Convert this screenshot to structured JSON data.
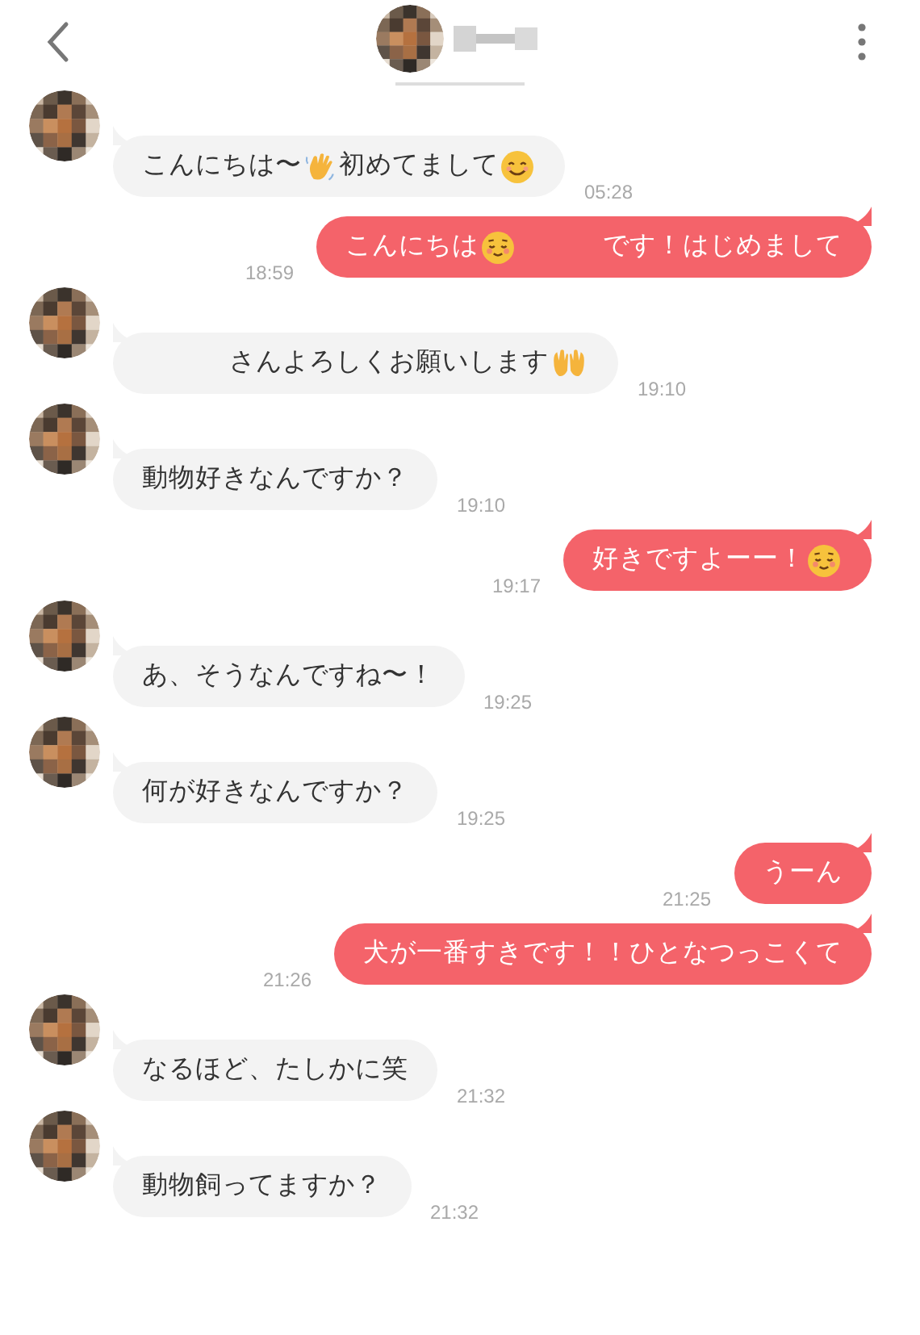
{
  "messages": [
    {
      "kind": "received",
      "time": "05:28",
      "parts": [
        {
          "kind": "text",
          "text": "こんにちは〜"
        },
        {
          "kind": "wave"
        },
        {
          "kind": "text",
          "text": "初めてまして"
        },
        {
          "kind": "smile"
        }
      ]
    },
    {
      "kind": "sent",
      "time": "18:59",
      "parts": [
        {
          "kind": "text",
          "text": "こんにちは"
        },
        {
          "kind": "relieved"
        },
        {
          "kind": "gap"
        },
        {
          "kind": "text",
          "text": "です！はじめまして"
        }
      ]
    },
    {
      "kind": "received",
      "time": "19:10",
      "parts": [
        {
          "kind": "gap"
        },
        {
          "kind": "text",
          "text": "さんよろしくお願いします"
        },
        {
          "kind": "hands"
        }
      ]
    },
    {
      "kind": "received",
      "time": "19:10",
      "parts": [
        {
          "kind": "text",
          "text": "動物好きなんですか？"
        }
      ]
    },
    {
      "kind": "sent",
      "time": "19:17",
      "parts": [
        {
          "kind": "text",
          "text": "好きですよーー！"
        },
        {
          "kind": "relieved"
        }
      ]
    },
    {
      "kind": "received",
      "time": "19:25",
      "parts": [
        {
          "kind": "text",
          "text": "あ、そうなんですね〜！"
        }
      ]
    },
    {
      "kind": "received",
      "time": "19:25",
      "parts": [
        {
          "kind": "text",
          "text": "何が好きなんですか？"
        }
      ]
    },
    {
      "kind": "sent",
      "time": "21:25",
      "parts": [
        {
          "kind": "text",
          "text": "うーん"
        }
      ]
    },
    {
      "kind": "sent",
      "time": "21:26",
      "parts": [
        {
          "kind": "text",
          "text": "犬が一番すきです！！ひとなつっこくて"
        }
      ]
    },
    {
      "kind": "received",
      "time": "21:32",
      "parts": [
        {
          "kind": "text",
          "text": "なるほど、たしかに笑"
        }
      ]
    },
    {
      "kind": "received",
      "time": "21:32",
      "parts": [
        {
          "kind": "text",
          "text": "動物飼ってますか？"
        }
      ]
    }
  ]
}
